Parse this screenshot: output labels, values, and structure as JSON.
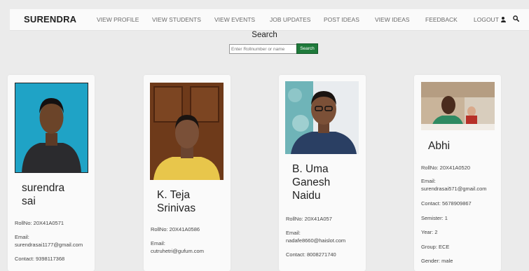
{
  "nav": {
    "brand": "SURENDRA",
    "links": [
      "VIEW PROFILE",
      "VIEW STUDENTS",
      "VIEW EVENTS",
      "JOB UPDATES",
      "POST IDEAS",
      "VIEW IDEAS",
      "FEEDBACK"
    ],
    "logout": "LOGOUT",
    "icons": [
      "user-icon",
      "search-icon"
    ]
  },
  "search": {
    "title": "Search",
    "placeholder": "Enter Rollnumber or name",
    "button": "Search"
  },
  "students": [
    {
      "name_lines": [
        "surendra",
        "sai"
      ],
      "roll": "RollNo: 20X41A0571",
      "email_label": "Email:",
      "email": "surendrasai1177@gmail.com",
      "contact": "Contact: 9398117368"
    },
    {
      "name_lines": [
        "K. Teja",
        "Srinivas"
      ],
      "roll": "RollNo: 20X41A0586",
      "email_label": "Email:",
      "email": "cutruhetri@gufum.com"
    },
    {
      "name_lines": [
        "B. Uma",
        "Ganesh",
        "Naidu"
      ],
      "roll": "RollNo: 20X41A057",
      "email_label": "Email:",
      "email": "nadafe8660@haislot.com",
      "contact": "Contact: 8008271740"
    },
    {
      "name_lines": [
        "Abhi"
      ],
      "roll": "RollNo: 20X41A0520",
      "email_label": "Email:",
      "email": "surendrasai571@gmail.com",
      "contact": "Contact: 5678909867",
      "semister": "Semister: 1",
      "year": "Year: 2",
      "group": "Group: ECE",
      "gender": "Gender: male"
    }
  ]
}
